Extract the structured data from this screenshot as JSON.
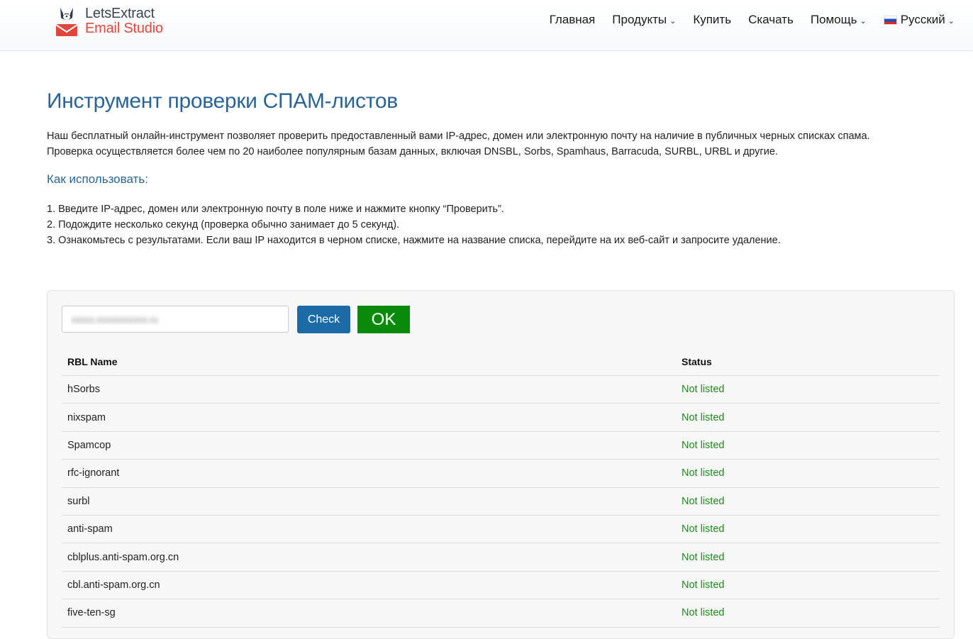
{
  "header": {
    "logo": {
      "line1": "LetsExtract",
      "line2": "Email Studio"
    },
    "nav": [
      {
        "label": "Главная",
        "dropdown": false
      },
      {
        "label": "Продукты",
        "dropdown": true
      },
      {
        "label": "Купить",
        "dropdown": false
      },
      {
        "label": "Скачать",
        "dropdown": false
      },
      {
        "label": "Помощь",
        "dropdown": true
      }
    ],
    "language": {
      "label": "Русский",
      "flag": "ru-flag-icon"
    }
  },
  "main": {
    "title": "Инструмент проверки СПАМ-листов",
    "intro_line1": "Наш бесплатный онлайн-инструмент позволяет проверить предоставленный вами IP-адрес, домен или электронную почту на наличие в публичных черных списках спама.",
    "intro_line2": "Проверка осуществляется более чем по 20 наиболее популярным базам данных, включая DNSBL, Sorbs, Spamhaus, Barracuda, SURBL, URBL и другие.",
    "how_title": "Как использовать:",
    "steps": [
      "1. Введите IP-адрес, домен или электронную почту в поле ниже и нажмите кнопку “Проверить”.",
      "2. Подождите несколько секунд (проверка обычно занимает до 5 секунд).",
      "3. Ознакомьтесь с результатами. Если ваш IP находится в черном списке, нажмите на название списка, перейдите на их веб-сайт и запросите удаление."
    ]
  },
  "tool": {
    "input_value": "xxxxx.xxxxxxxxxxx.ru",
    "check_label": "Check",
    "result_label": "OK",
    "table": {
      "headers": {
        "name": "RBL Name",
        "status": "Status"
      },
      "rows": [
        {
          "name": "hSorbs",
          "status": "Not listed"
        },
        {
          "name": "nixspam",
          "status": "Not listed"
        },
        {
          "name": "Spamcop",
          "status": "Not listed"
        },
        {
          "name": "rfc-ignorant",
          "status": "Not listed"
        },
        {
          "name": "surbl",
          "status": "Not listed"
        },
        {
          "name": "anti-spam",
          "status": "Not listed"
        },
        {
          "name": "cblplus.anti-spam.org.cn",
          "status": "Not listed"
        },
        {
          "name": "cbl.anti-spam.org.cn",
          "status": "Not listed"
        },
        {
          "name": "five-ten-sg",
          "status": "Not listed"
        }
      ]
    }
  },
  "colors": {
    "title": "#2a6496",
    "check_button": "#1c6aa6",
    "ok_badge": "#0a8a0a",
    "status_ok": "#1e8a1e",
    "logo_red": "#e0463b"
  }
}
